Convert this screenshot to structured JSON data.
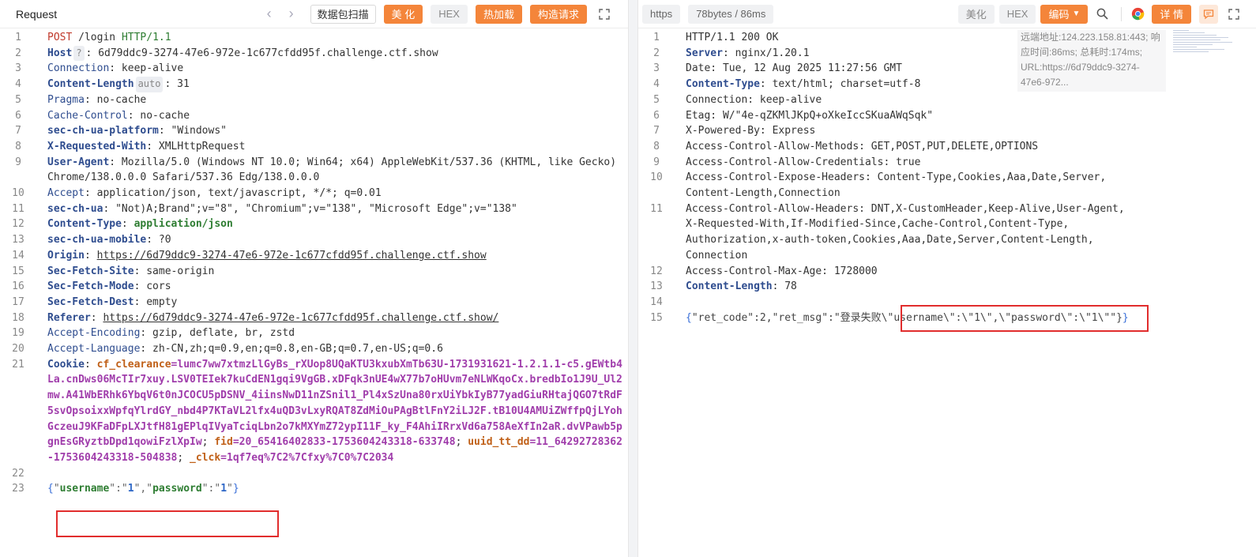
{
  "left": {
    "title": "Request",
    "buttons": {
      "scan": "数据包扫描",
      "beautify": "美 化",
      "hex": "HEX",
      "hot_load": "热加载",
      "construct": "构造请求"
    },
    "lines": {
      "l1": {
        "no": "1",
        "method": "POST",
        "path": " /login ",
        "proto": "HTTP/1.1"
      },
      "l2": {
        "no": "2",
        "key": "Host",
        "badge": "?",
        "val": ": 6d79ddc9-3274-47e6-972e-1c677cfdd95f.challenge.ctf.show"
      },
      "l3": {
        "no": "3",
        "key": "Connection",
        "val": ": keep-alive"
      },
      "l4": {
        "no": "4",
        "key": "Content-Length",
        "badge": "auto",
        "val": ": 31"
      },
      "l5": {
        "no": "5",
        "key": "Pragma",
        "val": ": no-cache"
      },
      "l6": {
        "no": "6",
        "key": "Cache-Control",
        "val": ": no-cache"
      },
      "l7": {
        "no": "7",
        "key": "sec-ch-ua-platform",
        "val": ": \"Windows\""
      },
      "l8": {
        "no": "8",
        "key": "X-Requested-With",
        "val": ": XMLHttpRequest"
      },
      "l9": {
        "no": "9",
        "key": "User-Agent",
        "val": ": Mozilla/5.0 (Windows NT 10.0; Win64; x64) AppleWebKit/537.36 (KHTML, like Gecko) Chrome/138.0.0.0 Safari/537.36 Edg/138.0.0.0"
      },
      "l10": {
        "no": "10",
        "key": "Accept",
        "val": ": application/json, text/javascript, */*; q=0.01"
      },
      "l11": {
        "no": "11",
        "key": "sec-ch-ua",
        "val": ": \"Not)A;Brand\";v=\"8\", \"Chromium\";v=\"138\", \"Microsoft Edge\";v=\"138\""
      },
      "l12": {
        "no": "12",
        "key": "Content-Type",
        "val": "application/json"
      },
      "l13": {
        "no": "13",
        "key": "sec-ch-ua-mobile",
        "val": ": ?0"
      },
      "l14": {
        "no": "14",
        "key": "Origin",
        "val": "https://6d79ddc9-3274-47e6-972e-1c677cfdd95f.challenge.ctf.show"
      },
      "l15": {
        "no": "15",
        "key": "Sec-Fetch-Site",
        "val": ": same-origin"
      },
      "l16": {
        "no": "16",
        "key": "Sec-Fetch-Mode",
        "val": ": cors"
      },
      "l17": {
        "no": "17",
        "key": "Sec-Fetch-Dest",
        "val": ": empty"
      },
      "l18": {
        "no": "18",
        "key": "Referer",
        "val": "https://6d79ddc9-3274-47e6-972e-1c677cfdd95f.challenge.ctf.show/"
      },
      "l19": {
        "no": "19",
        "key": "Accept-Encoding",
        "val": ": gzip, deflate, br, zstd"
      },
      "l20": {
        "no": "20",
        "key": "Accept-Language",
        "val": ": zh-CN,zh;q=0.9,en;q=0.8,en-GB;q=0.7,en-US;q=0.6"
      },
      "l21": {
        "no": "21",
        "key": "Cookie",
        "c1_key": "cf_clearance",
        "c1_val": "=lumc7ww7xtmzLlGyBs_rXUop8UQaKTU3kxubXmTb63U-1731931621-1.2.1.1-c5.gEWtb4La.cnDws06McTIr7xuy.LSV0TEIek7kuCdEN1gqi9VgGB.xDFqk3nUE4wX77b7oHUvm7eNLWKqoCx.bredbIo1J9U_Ul2mw.A41WbERhk6YbqV6t0nJCOCU5pDSNV_4iinsNwD11nZSnil1_Pl4xSzUna80rxUiYbkIyB77yadGiuRHtajQGO7tRdF5svOpsoixxWpfqYlrdGY_nbd4P7KTaVL2lfx4uQD3vLxyRQAT8ZdMiOuPAgBtlFnY2iLJ2F.tB10U4AMUiZWffpQjLYohGczeuJ9KFaDFpLXJtfH81gEPlqIVyaTciqLbn2o7kMXYmZ72ypI11F_ky_F4AhiIRrxVd6a758AeXfIn2aR.dvVPawb5pgnEsGRyztbDpd1qowiFzlXpIw",
        "c2_key": "fid",
        "c2_val": "=20_65416402833-1753604243318-633748",
        "c3_key": "uuid_tt_dd",
        "c3_val": "=11_64292728362-1753604243318-504838",
        "c4_key": "_clck",
        "c4_val": "=1qf7eq%7C2%7Cfxy%7C0%7C2034"
      },
      "l22": {
        "no": "22"
      },
      "l23": {
        "no": "23",
        "k1": "username",
        "v1": "1",
        "k2": "password",
        "v2": "1"
      }
    }
  },
  "right": {
    "protocol_chip": "https",
    "size_chip": "78bytes / 86ms",
    "buttons": {
      "beautify": "美化",
      "hex": "HEX",
      "encoding": "编码",
      "details": "详 情"
    },
    "tooltip": "远端地址:124.223.158.81:443; 响应时间:86ms; 总耗时:174ms; URL:https://6d79ddc9-3274-47e6-972...",
    "lines": {
      "l1": {
        "no": "1",
        "text": "HTTP/1.1 200 OK"
      },
      "l2": {
        "no": "2",
        "key": "Server",
        "val": ": nginx/1.20.1"
      },
      "l3": {
        "no": "3",
        "text": "Date: Tue, 12 Aug 2025 11:27:56 GMT"
      },
      "l4": {
        "no": "4",
        "key": "Content-Type",
        "val": ": text/html; charset=utf-8"
      },
      "l5": {
        "no": "5",
        "text": "Connection: keep-alive"
      },
      "l6": {
        "no": "6",
        "text": "Etag: W/\"4e-qZKMlJKpQ+oXkeIccSKuaAWqSqk\""
      },
      "l7": {
        "no": "7",
        "text": "X-Powered-By: Express"
      },
      "l8": {
        "no": "8",
        "text": "Access-Control-Allow-Methods: GET,POST,PUT,DELETE,OPTIONS"
      },
      "l9": {
        "no": "9",
        "text": "Access-Control-Allow-Credentials: true"
      },
      "l10": {
        "no": "10",
        "text": "Access-Control-Expose-Headers: Content-Type,Cookies,Aaa,Date,Server,\nContent-Length,Connection"
      },
      "l11": {
        "no": "11",
        "text": "Access-Control-Allow-Headers: DNT,X-CustomHeader,Keep-Alive,User-Agent,\nX-Requested-With,If-Modified-Since,Cache-Control,Content-Type,\nAuthorization,x-auth-token,Cookies,Aaa,Date,Server,Content-Length,\nConnection"
      },
      "l12": {
        "no": "12",
        "text": "Access-Control-Max-Age: 1728000"
      },
      "l13": {
        "no": "13",
        "key": "Content-Length",
        "val": ": 78"
      },
      "l14": {
        "no": "14"
      },
      "l15": {
        "no": "15",
        "pre": "\"ret_code\":2,\"ret_msg\":\"登录失败",
        "boxed": "\\\"username\\\":\\\"1\\\",\\\"password\\\":\\\"1\\\"",
        "post": "\"}"
      }
    }
  }
}
